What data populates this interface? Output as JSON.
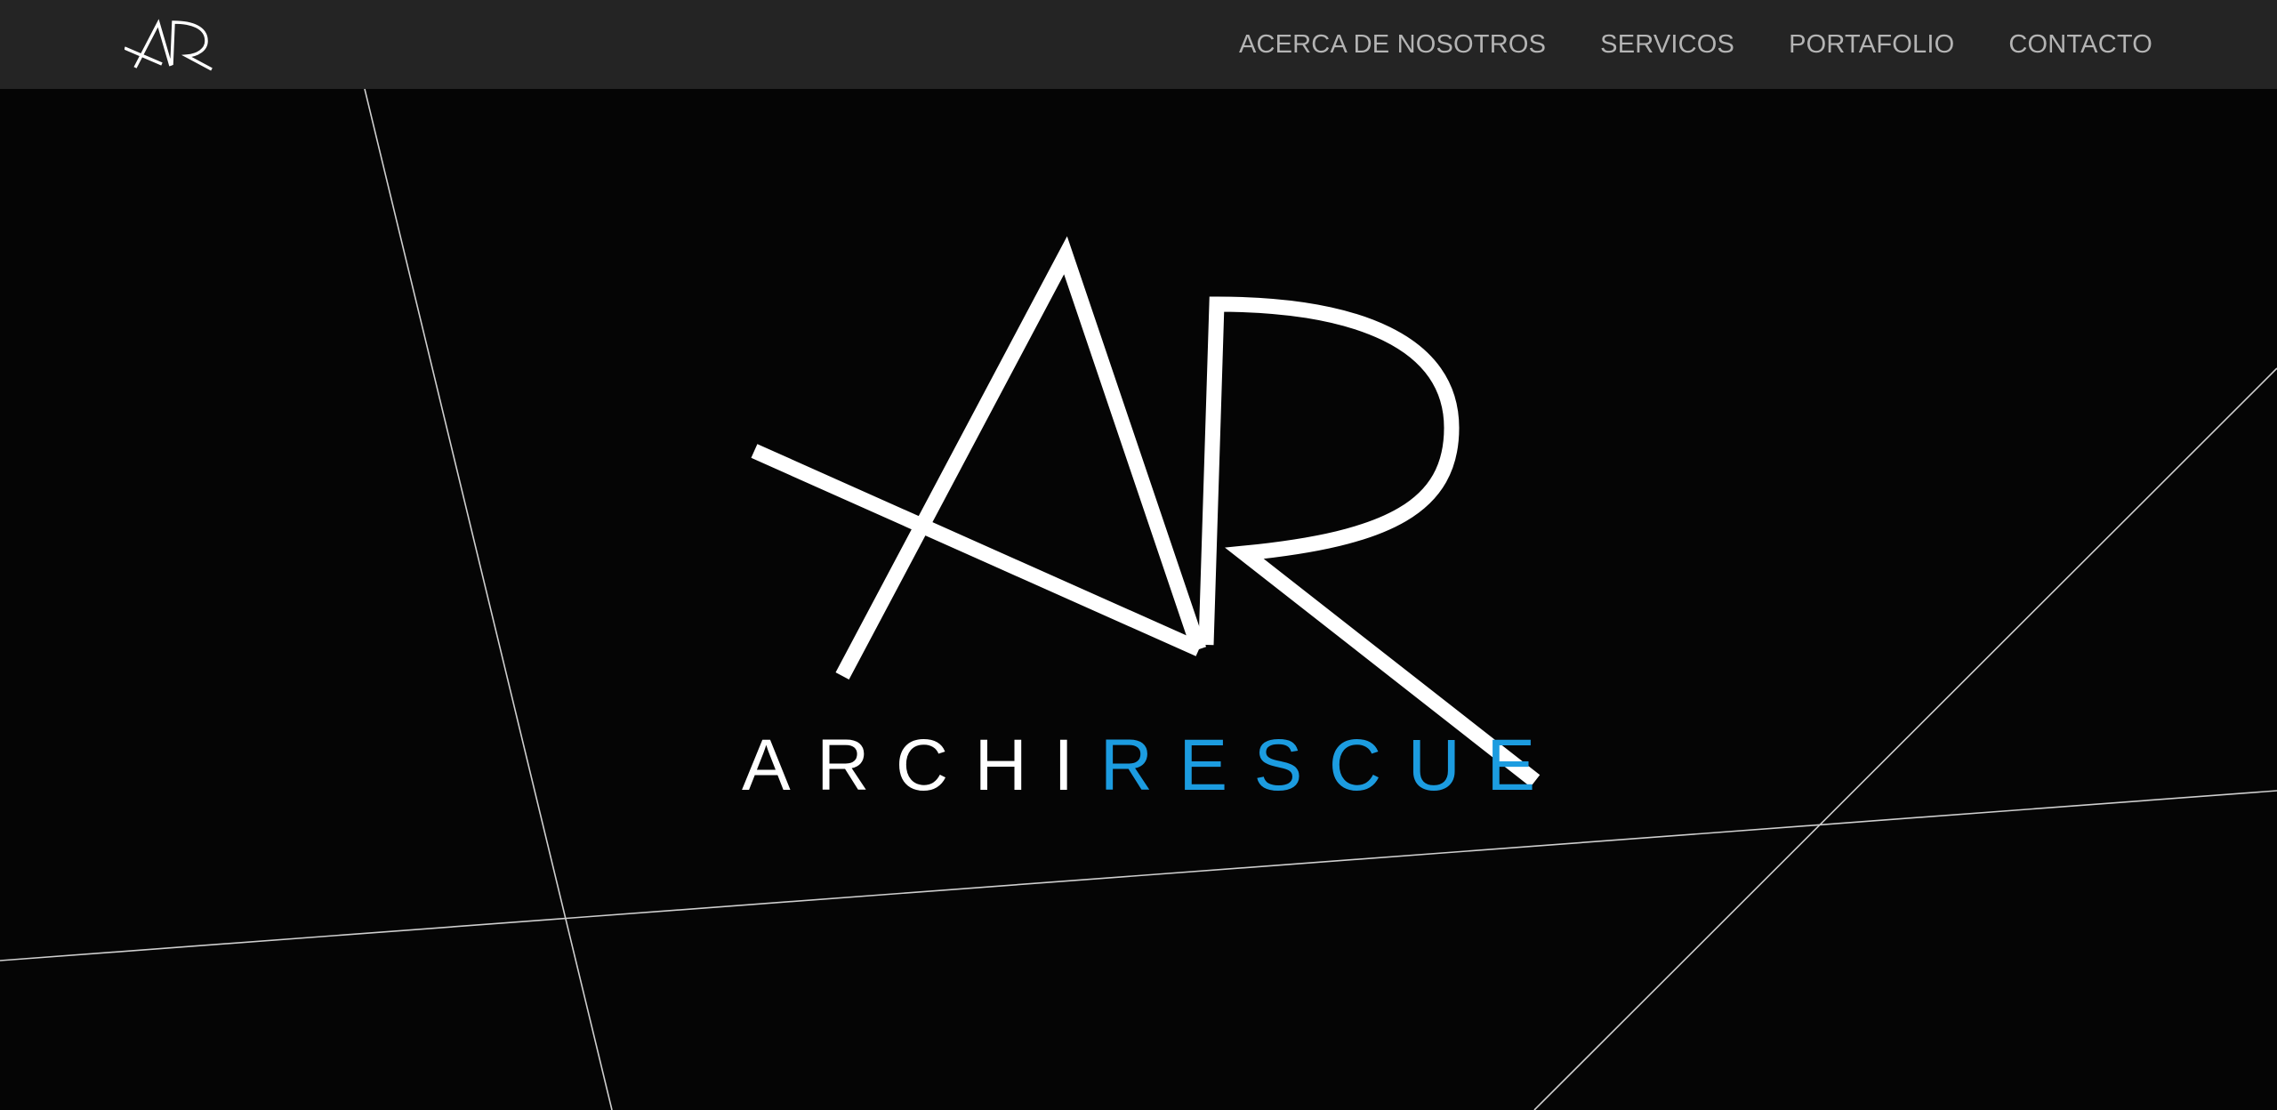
{
  "nav": {
    "links": [
      {
        "label": "ACERCA DE NOSOTROS"
      },
      {
        "label": "SERVICOS"
      },
      {
        "label": "PORTAFOLIO"
      },
      {
        "label": "CONTACTO"
      }
    ]
  },
  "hero": {
    "brand_part_1": "ARCHI",
    "brand_part_2": "RESCUE"
  },
  "colors": {
    "navbar_background": "#242424",
    "page_background": "#050505",
    "nav_text": "#b4b4b4",
    "brand_white": "#ffffff",
    "brand_accent": "#1c9ce0"
  },
  "logo": {
    "icon": "ar-monogram-logo",
    "lettering": "AR"
  }
}
